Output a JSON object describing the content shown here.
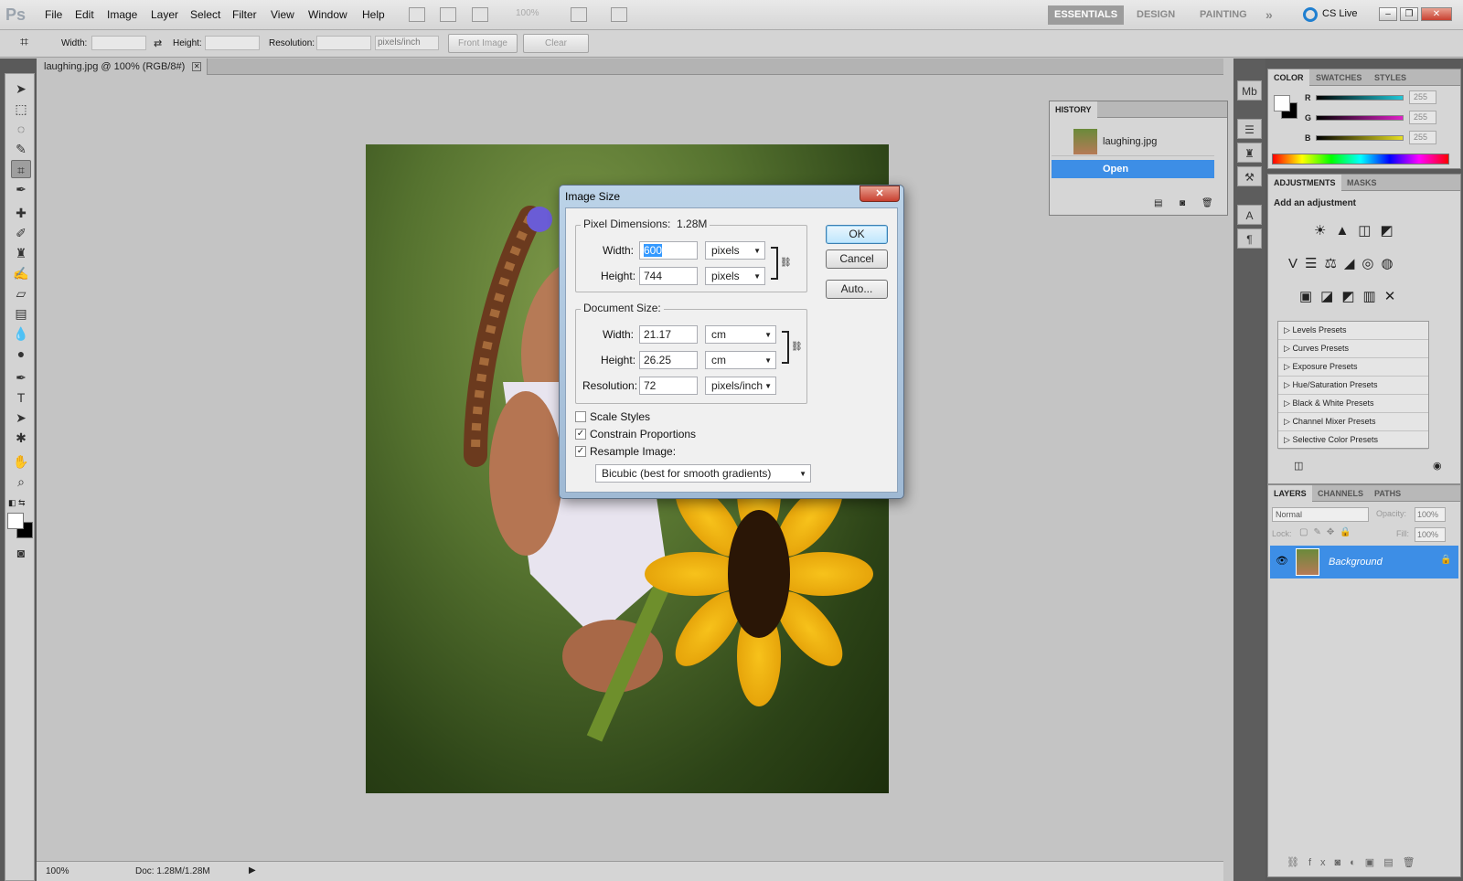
{
  "app": {
    "logo": "Ps",
    "menu": [
      "File",
      "Edit",
      "Image",
      "Layer",
      "Select",
      "Filter",
      "View",
      "Window",
      "Help"
    ],
    "zoom_display": "100%",
    "workspaces": [
      "ESSENTIALS",
      "DESIGN",
      "PAINTING"
    ],
    "active_workspace": "ESSENTIALS",
    "more_workspaces": "»",
    "cslive": "CS Live"
  },
  "options_bar": {
    "width_label": "Width:",
    "height_label": "Height:",
    "resolution_label": "Resolution:",
    "resolution_unit": "pixels/inch",
    "front_image": "Front Image",
    "clear": "Clear"
  },
  "document": {
    "tab_title": "laughing.jpg @ 100% (RGB/8#)",
    "status_zoom": "100%",
    "status_doc": "Doc: 1.28M/1.28M"
  },
  "history": {
    "title": "HISTORY",
    "snapshot": "laughing.jpg",
    "states": [
      "Open"
    ]
  },
  "color_panel": {
    "tabs": [
      "COLOR",
      "SWATCHES",
      "STYLES"
    ],
    "channels": [
      {
        "name": "R",
        "value": "255",
        "color": "#20c8d8"
      },
      {
        "name": "G",
        "value": "255",
        "color": "#e020c8"
      },
      {
        "name": "B",
        "value": "255",
        "color": "#e8e020"
      }
    ]
  },
  "adjustments_panel": {
    "tabs": [
      "ADJUSTMENTS",
      "MASKS"
    ],
    "heading": "Add an adjustment",
    "presets": [
      "Levels Presets",
      "Curves Presets",
      "Exposure Presets",
      "Hue/Saturation Presets",
      "Black & White Presets",
      "Channel Mixer Presets",
      "Selective Color Presets"
    ]
  },
  "layers_panel": {
    "tabs": [
      "LAYERS",
      "CHANNELS",
      "PATHS"
    ],
    "blend_mode": "Normal",
    "opacity_label": "Opacity:",
    "opacity_value": "100%",
    "lock_label": "Lock:",
    "fill_label": "Fill:",
    "fill_value": "100%",
    "layer_name": "Background"
  },
  "dialog": {
    "title": "Image Size",
    "pixel_dimensions_label": "Pixel Dimensions:",
    "pixel_dimensions_value": "1.28M",
    "px_width_label": "Width:",
    "px_width_value": "600",
    "px_width_unit": "pixels",
    "px_height_label": "Height:",
    "px_height_value": "744",
    "px_height_unit": "pixels",
    "document_size_label": "Document Size:",
    "doc_width_label": "Width:",
    "doc_width_value": "21.17",
    "doc_width_unit": "cm",
    "doc_height_label": "Height:",
    "doc_height_value": "26.25",
    "doc_height_unit": "cm",
    "resolution_label": "Resolution:",
    "resolution_value": "72",
    "resolution_unit": "pixels/inch",
    "scale_styles": "Scale Styles",
    "scale_styles_checked": false,
    "constrain": "Constrain Proportions",
    "constrain_checked": true,
    "resample": "Resample Image:",
    "resample_checked": true,
    "resample_method": "Bicubic (best for smooth gradients)",
    "ok": "OK",
    "cancel": "Cancel",
    "auto": "Auto..."
  }
}
